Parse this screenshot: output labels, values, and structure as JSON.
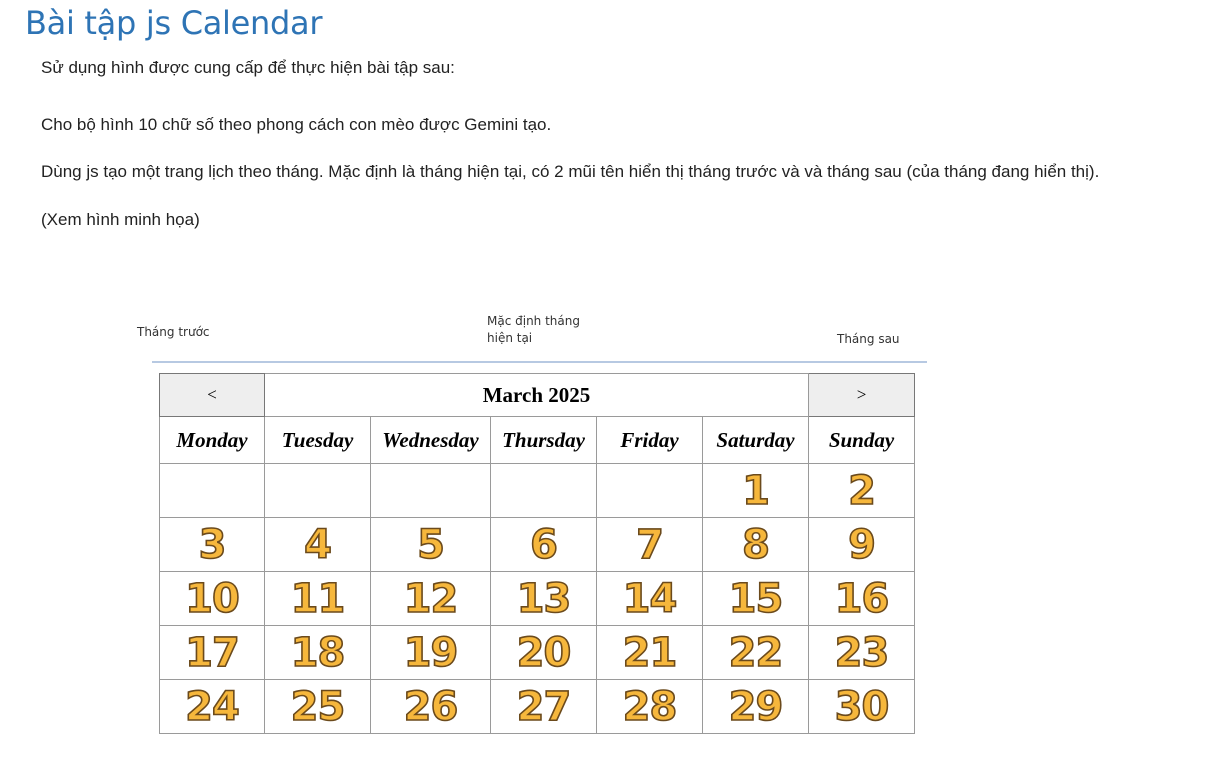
{
  "page": {
    "title": "Bài tập js Calendar",
    "paragraphs": [
      "Sử dụng hình được cung cấp để thực hiện bài tập sau:",
      "Cho bộ hình 10 chữ số theo phong cách con mèo được Gemini tạo.",
      "Dùng js tạo một trang lịch theo tháng. Mặc định là tháng hiện tại, có 2 mũi tên hiển thị tháng trước và và tháng sau (của tháng đang hiển thị).",
      "(Xem hình minh họa)"
    ]
  },
  "illustration": {
    "annot_prev": "Tháng trước",
    "annot_current_line1": "Mặc định tháng",
    "annot_current_line2": "hiện tại",
    "annot_next": "Tháng sau"
  },
  "calendar": {
    "prev_label": "<",
    "next_label": ">",
    "month_title": "March 2025",
    "weekdays": [
      "Monday",
      "Tuesday",
      "Wednesday",
      "Thursday",
      "Friday",
      "Saturday",
      "Sunday"
    ],
    "weeks": [
      [
        "",
        "",
        "",
        "",
        "",
        "1",
        "2"
      ],
      [
        "3",
        "4",
        "5",
        "6",
        "7",
        "8",
        "9"
      ],
      [
        "10",
        "11",
        "12",
        "13",
        "14",
        "15",
        "16"
      ],
      [
        "17",
        "18",
        "19",
        "20",
        "21",
        "22",
        "23"
      ],
      [
        "24",
        "25",
        "26",
        "27",
        "28",
        "29",
        "30"
      ]
    ],
    "digit_color": "#f6b73c",
    "digit_outline": "#6b4a1c",
    "nav_bg": "#eeeeee",
    "title_color": "#2e74b5"
  }
}
